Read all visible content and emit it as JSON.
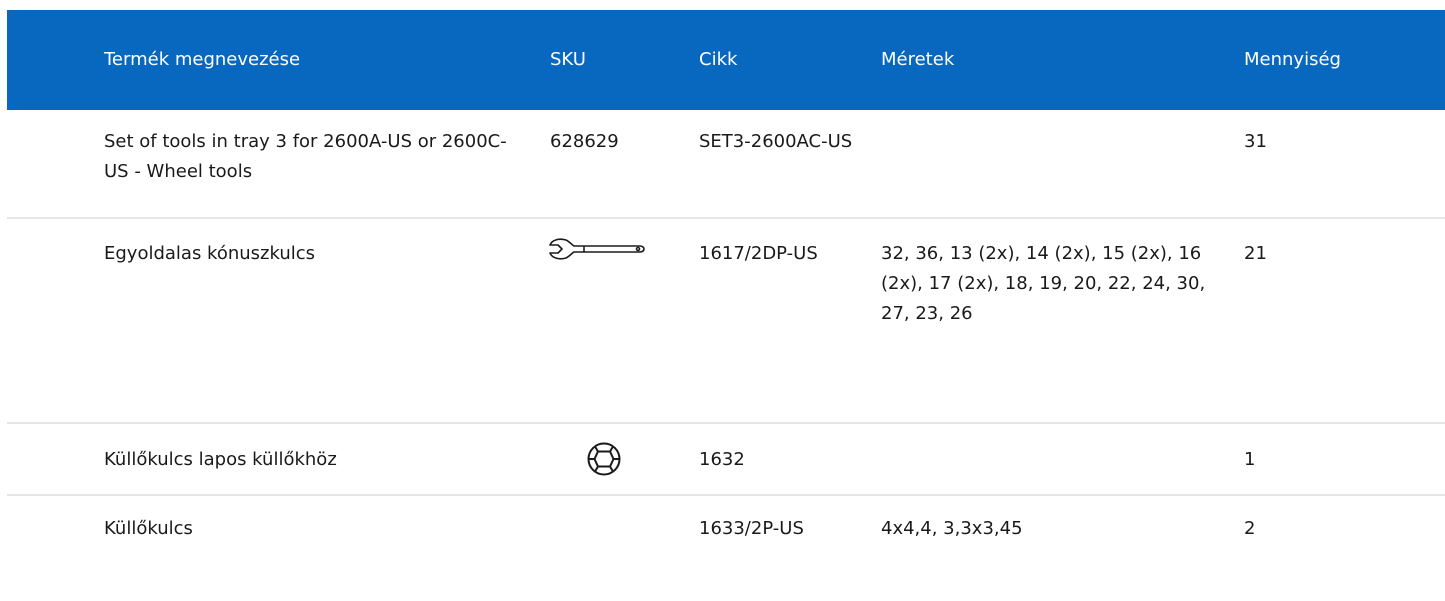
{
  "table": {
    "headers": {
      "name": "Termék megnevezése",
      "sku": "SKU",
      "article": "Cikk",
      "sizes": "Méretek",
      "qty": "Mennyiség"
    },
    "rows": [
      {
        "name": "Set of tools in tray 3 for 2600A-US or 2600C-US - Wheel tools",
        "sku": "628629",
        "sku_icon": "",
        "article": "SET3-2600AC-US",
        "sizes": "",
        "qty": "31"
      },
      {
        "name": "Egyoldalas kónuszkulcs",
        "sku": "",
        "sku_icon": "cone-wrench-icon",
        "article": "1617/2DP-US",
        "sizes": "32, 36, 13 (2x), 14 (2x), 15 (2x), 16 (2x), 17 (2x), 18, 19, 20, 22, 24, 30, 27, 23, 26",
        "qty": "21"
      },
      {
        "name": "Küllőkulcs lapos küllőkhöz",
        "sku": "",
        "sku_icon": "spoke-wrench-icon",
        "article": "1632",
        "sizes": "",
        "qty": "1"
      },
      {
        "name": "Küllőkulcs",
        "sku": "",
        "sku_icon": "",
        "article": "1633/2P-US",
        "sizes": "4x4,4, 3,3x3,45",
        "qty": "2"
      }
    ]
  },
  "colors": {
    "header_bg": "#0867bf",
    "header_text": "#ffffff",
    "row_divider": "#e6e6e6",
    "body_text": "#1a1a1a"
  }
}
